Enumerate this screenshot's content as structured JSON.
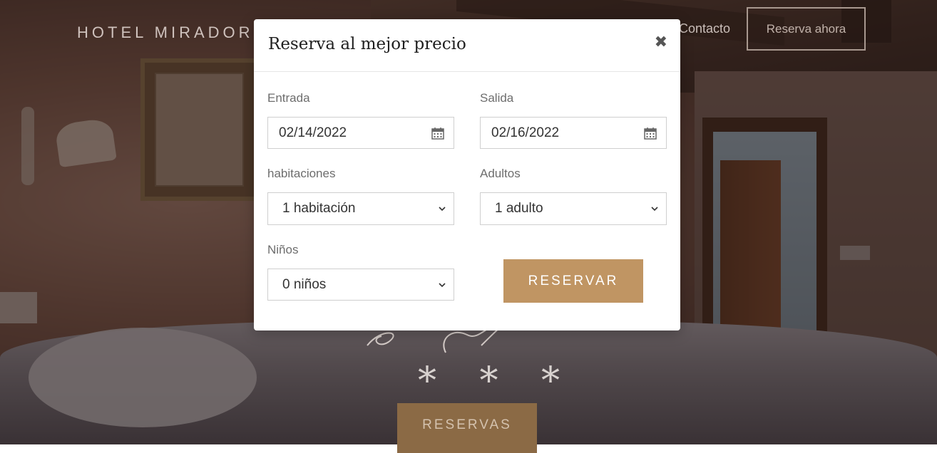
{
  "navbar": {
    "brand": "HOTEL MIRADOR",
    "contact_link": "Contacto",
    "cta": "Reserva ahora"
  },
  "hero": {
    "stars": "* * *",
    "button": "RESERVAS"
  },
  "modal": {
    "title": "Reserva al mejor precio",
    "close_icon": "times-icon",
    "checkin": {
      "label": "Entrada",
      "value": "02/14/2022",
      "icon": "calendar-icon"
    },
    "checkout": {
      "label": "Salida",
      "value": "02/16/2022",
      "icon": "calendar-icon"
    },
    "rooms": {
      "label": "habitaciones",
      "value": "1 habitación"
    },
    "adults": {
      "label": "Adultos",
      "value": "1 adulto"
    },
    "children": {
      "label": "Niños",
      "value": "0 niños"
    },
    "submit": "RESERVAR"
  },
  "colors": {
    "accent": "#c09563",
    "overlay": "#1e1412"
  }
}
